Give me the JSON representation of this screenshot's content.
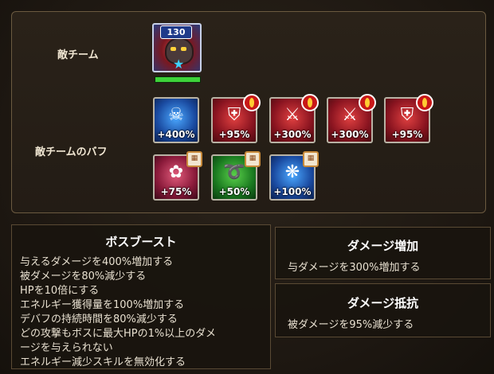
{
  "enemy_team_label": "敵チーム",
  "enemy_buff_label": "敵チームのバフ",
  "boss": {
    "level": "130",
    "hp_fraction": 1.0
  },
  "buffs": [
    {
      "value": "+400%",
      "icon": "skull-icon",
      "color": "blue",
      "badge": "none"
    },
    {
      "value": "+95%",
      "icon": "sword-shield-icon",
      "color": "red",
      "badge": "eye"
    },
    {
      "value": "+300%",
      "icon": "crossed-swords-icon",
      "color": "red",
      "badge": "eye"
    },
    {
      "value": "+300%",
      "icon": "crossed-swords-icon",
      "color": "red",
      "badge": "eye"
    },
    {
      "value": "+95%",
      "icon": "sword-shield-icon",
      "color": "red",
      "badge": "eye"
    },
    {
      "value": "+75%",
      "icon": "rose-icon",
      "color": "pink",
      "badge": "calendar"
    },
    {
      "value": "+50%",
      "icon": "swirl-icon",
      "color": "green",
      "badge": "calendar"
    },
    {
      "value": "+100%",
      "icon": "paw-icon",
      "color": "blue",
      "badge": "calendar"
    }
  ],
  "boss_boost": {
    "title": "ボスブースト",
    "lines": [
      "与えるダメージを400%増加する",
      "被ダメージを80%減少する",
      "HPを10倍にする",
      "エネルギー獲得量を100%増加する",
      "デバフの持続時間を80%減少する",
      "どの攻撃もボスに最大HPの1%以上のダメ",
      "ージを与えられない",
      "エネルギー減少スキルを無効化する"
    ]
  },
  "damage_up": {
    "title": "ダメージ増加",
    "line": "与ダメージを300%増加する"
  },
  "damage_resist": {
    "title": "ダメージ抵抗",
    "line": "被ダメージを95%減少する"
  }
}
